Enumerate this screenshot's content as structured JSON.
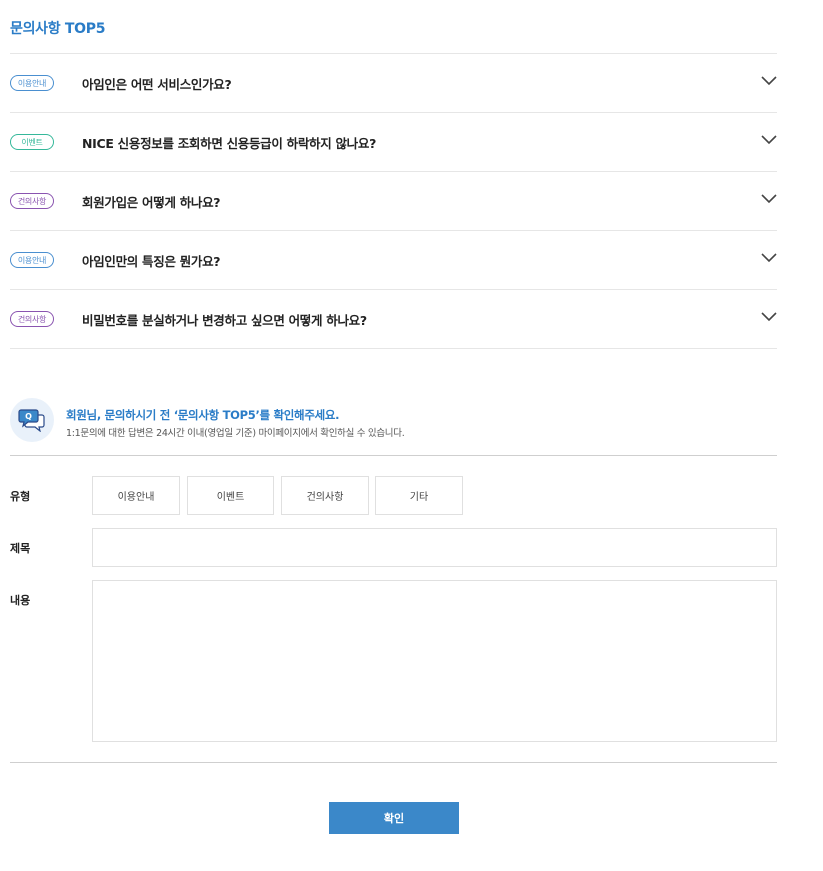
{
  "section": {
    "title": "문의사항 TOP5"
  },
  "faq": [
    {
      "category": "이용안내",
      "question": "아임인은 어떤 서비스인가요?"
    },
    {
      "category": "이벤트",
      "question": "NICE 신용정보를 조회하면 신용등급이 하락하지 않나요?"
    },
    {
      "category": "건의사항",
      "question": "회원가입은 어떻게 하나요?"
    },
    {
      "category": "이용안내",
      "question": "아임인만의 특징은 뭔가요?"
    },
    {
      "category": "건의사항",
      "question": "비밀번호를 분실하거나 변경하고 싶으면 어떻게 하나요?"
    }
  ],
  "notice": {
    "icon": "q-speech-bubble-icon",
    "title": "회원님, 문의하시기 전 ‘문의사항 TOP5’를 확인해주세요.",
    "desc": "1:1문의에 대한 답변은 24시간 이내(영업일 기준) 마이페이지에서 확인하실 수 있습니다."
  },
  "form": {
    "type_label": "유형",
    "types": [
      "이용안내",
      "이벤트",
      "건의사항",
      "기타"
    ],
    "title_label": "제목",
    "title_value": "",
    "body_label": "내용",
    "body_value": "",
    "submit_label": "확인"
  },
  "colors": {
    "accent": "#2a7cc7",
    "button": "#3b88c9",
    "badge_guide": "#4a8fd0",
    "badge_event": "#35b89a",
    "badge_suggest": "#8a54b0"
  }
}
